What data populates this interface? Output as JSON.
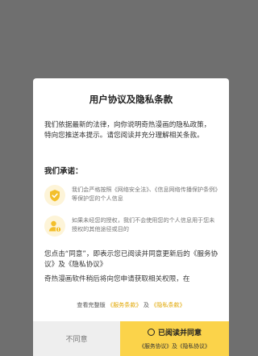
{
  "dialog": {
    "title": "用户协议及隐私条款",
    "intro": "我们依据最新的法律，向你说明奇热漫画的隐私政策，特向您推送本提示。请您阅读并充分理解相关条款。",
    "promise_heading": "我们承诺：",
    "promises": [
      {
        "icon": "shield-check-icon",
        "text": "我们会严格按照《网络安全法》、《信息网络传播保护条例》等保护您的个人信息"
      },
      {
        "icon": "user-alert-icon",
        "text": "如果未经您的授权，我们不会使用您的个人信息用于您未授权的其他途径或目的"
      }
    ],
    "para1": "您点击“同意”，即表示您已阅读并同意更新后的《服务协议》及《隐私协议》",
    "para2": "奇热漫画软件稍后将向您申请获取相关权限，在",
    "view_full_prefix": "查看完整版",
    "service_link": "《服务条款》",
    "and_text": "及",
    "privacy_link": "《隐私条款》",
    "disagree_label": "不同意",
    "agree_label": "已阅读并同意",
    "agree_sub": "《服务协议》及《隐私协议》"
  },
  "colors": {
    "overlay": "#6f6f6f",
    "accent": "#fbd34a",
    "link": "#e0a600",
    "icon_bg": "#fdf4d8",
    "icon_fg": "#f3bf2b"
  }
}
